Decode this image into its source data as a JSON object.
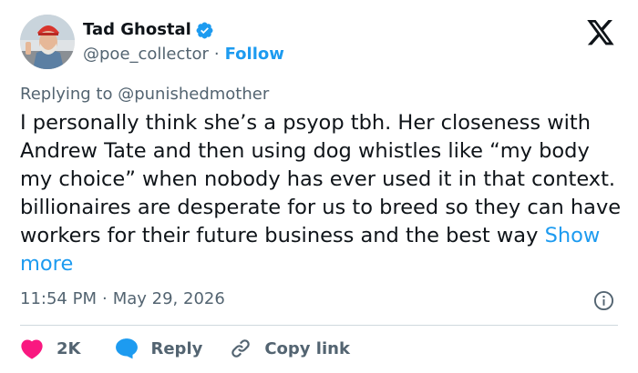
{
  "author": {
    "display_name": "Tad Ghostal",
    "handle": "@poe_collector",
    "follow_label": "Follow",
    "separator": "·"
  },
  "reply_context": {
    "prefix": "Replying to",
    "mention": "@punishedmother"
  },
  "tweet": {
    "text": "I personally think she’s a psyop tbh. Her closeness with Andrew Tate and then using dog whistles like “my body my choice” when nobody has ever used it in that context. billionaires are desperate for us to breed so they can have workers for their future business and the best way",
    "show_more_label": "Show more",
    "time": "11:54 PM",
    "date": "May 29, 2026",
    "date_separator": "·"
  },
  "actions": {
    "like_count": "2K",
    "reply_label": "Reply",
    "copy_link_label": "Copy link"
  },
  "icons": {
    "verified": "verified-badge-icon",
    "platform": "x-logo-icon",
    "info": "info-icon",
    "like": "heart-icon",
    "reply": "speech-bubble-icon",
    "copy": "link-icon"
  },
  "colors": {
    "accent": "#1d9bf0",
    "like": "#f91880",
    "muted": "#536471",
    "text": "#0f1419",
    "divider": "#cfd9de"
  }
}
